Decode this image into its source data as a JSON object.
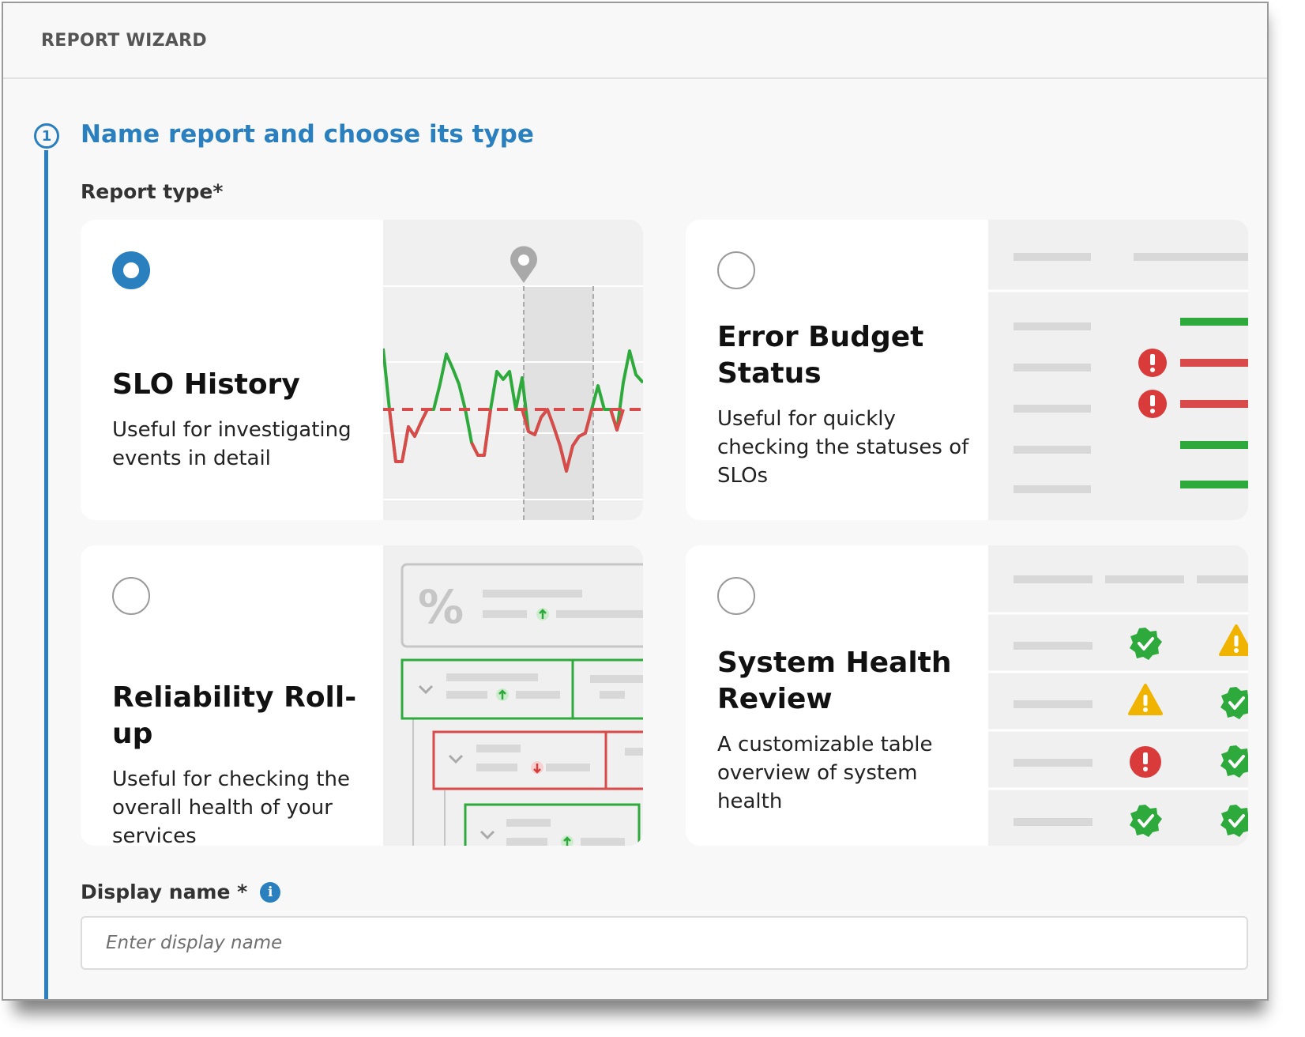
{
  "header": {
    "title": "REPORT WIZARD"
  },
  "step": {
    "number": "1",
    "title": "Name report and choose its type"
  },
  "report_type": {
    "label": "Report type*",
    "selected": "SLO History",
    "options": [
      {
        "title": "SLO History",
        "description": "Useful for investigating events in detail",
        "checked": true
      },
      {
        "title": "Error Budget Status",
        "description": "Useful for quickly checking the statuses of SLOs",
        "checked": false
      },
      {
        "title": "Reliability Roll-up",
        "description": "Useful for checking the overall health of your services",
        "checked": false
      },
      {
        "title": "System Health Review",
        "description": "A customizable table overview of system health",
        "checked": false
      }
    ]
  },
  "display_name": {
    "label": "Display name *",
    "placeholder": "Enter display name",
    "value": ""
  },
  "colors": {
    "accent": "#2a7fbf",
    "ok": "#2eaa3c",
    "error": "#d93a3a",
    "warning": "#f0b400"
  },
  "icons": {
    "info": "info-icon",
    "location_pin": "location-pin-icon",
    "error": "exclamation-circle-icon",
    "warning": "warning-triangle-icon",
    "ok": "check-badge-icon",
    "chevron": "chevron-down-icon",
    "arrow_up": "arrow-up-icon",
    "arrow_down": "arrow-down-icon"
  }
}
